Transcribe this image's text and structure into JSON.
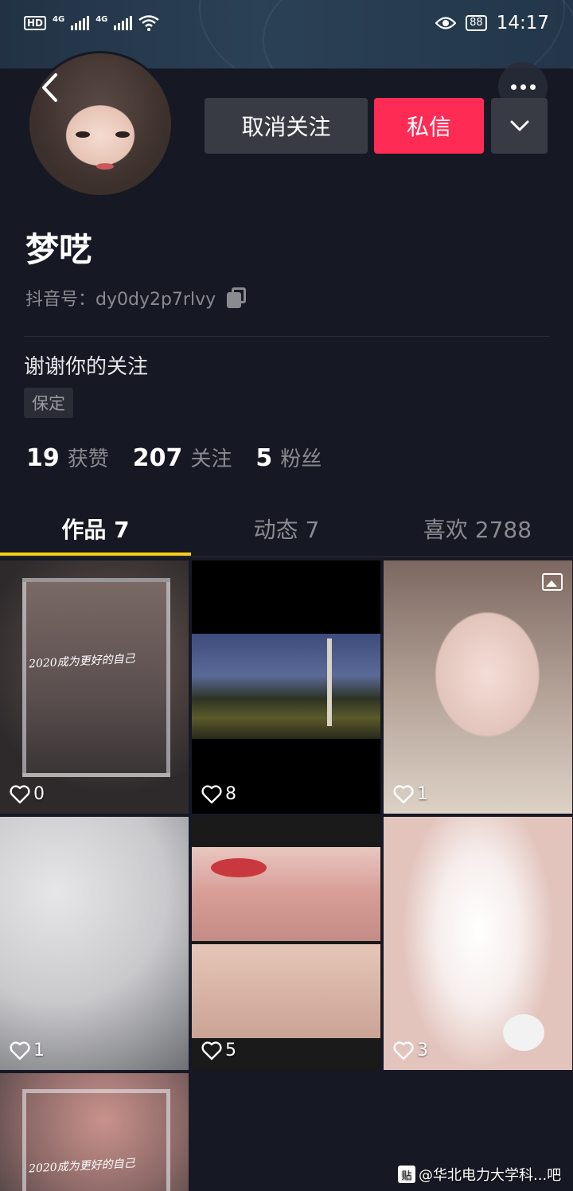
{
  "status_bar": {
    "left_badges": [
      "HD",
      "4G",
      "4G"
    ],
    "battery": "88",
    "time": "14:17"
  },
  "profile": {
    "unfollow_label": "取消关注",
    "message_label": "私信",
    "nickname": "梦呓",
    "douyin_id": "抖音号：dy0dy2p7rlvy",
    "bio": "谢谢你的关注",
    "tag": "保定",
    "stats": [
      {
        "num": "19",
        "label": "获赞"
      },
      {
        "num": "207",
        "label": "关注"
      },
      {
        "num": "5",
        "label": "粉丝"
      }
    ]
  },
  "tabs": [
    {
      "label": "作品 7",
      "active": true
    },
    {
      "label": "动态 7",
      "active": false
    },
    {
      "label": "喜欢 2788",
      "active": false
    }
  ],
  "grid": [
    {
      "likes": "0",
      "caption": "2020成为更好的自己",
      "theme": "blur-portrait"
    },
    {
      "likes": "8",
      "caption": "",
      "theme": "night-street"
    },
    {
      "likes": "1",
      "caption": "",
      "theme": "selfie",
      "photo_badge": true
    },
    {
      "likes": "1",
      "caption": "",
      "theme": "grey-blur"
    },
    {
      "likes": "5",
      "caption": "",
      "theme": "lips-eyes"
    },
    {
      "likes": "3",
      "caption": "",
      "theme": "hearts-white"
    },
    {
      "likes": "",
      "caption": "2020成为更好的自己",
      "theme": "blur-portrait-pink"
    }
  ],
  "watermark": "@华北电力大学科...吧",
  "watermark_logo": "贴"
}
